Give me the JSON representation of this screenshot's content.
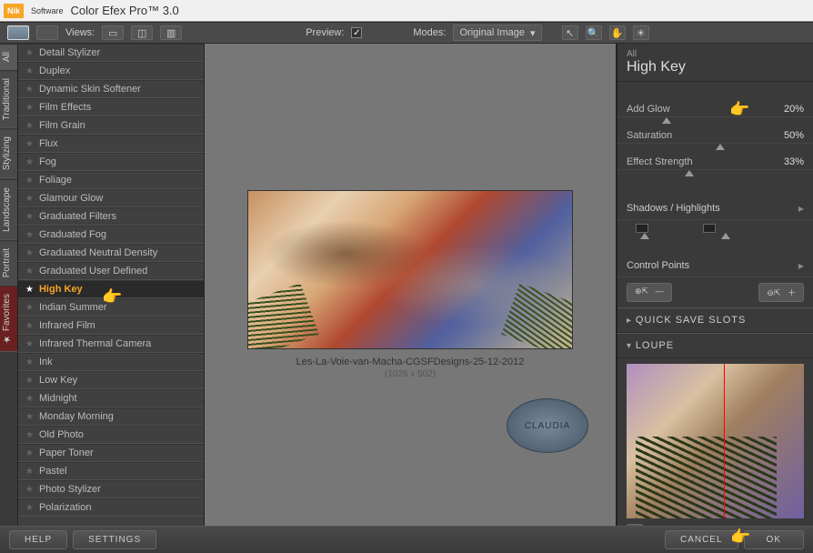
{
  "title": "Color Efex Pro™ 3.0",
  "brand": "Nik",
  "brand_sub": "Software",
  "toolbar": {
    "views": "Views:",
    "preview": "Preview:",
    "modes": "Modes:",
    "mode_value": "Original Image"
  },
  "tabs": [
    "All",
    "Traditional",
    "Stylizing",
    "Landscape",
    "Portrait",
    "Favorites"
  ],
  "filters": [
    {
      "label": "Detail Stylizer"
    },
    {
      "label": "Duplex"
    },
    {
      "label": "Dynamic Skin Softener"
    },
    {
      "label": "Film Effects"
    },
    {
      "label": "Film Grain"
    },
    {
      "label": "Flux"
    },
    {
      "label": "Fog"
    },
    {
      "label": "Foliage"
    },
    {
      "label": "Glamour Glow"
    },
    {
      "label": "Graduated Filters"
    },
    {
      "label": "Graduated Fog"
    },
    {
      "label": "Graduated Neutral Density"
    },
    {
      "label": "Graduated User Defined"
    },
    {
      "label": "High Key",
      "selected": true
    },
    {
      "label": "Indian Summer"
    },
    {
      "label": "Infrared Film"
    },
    {
      "label": "Infrared Thermal Camera"
    },
    {
      "label": "Ink"
    },
    {
      "label": "Low Key"
    },
    {
      "label": "Midnight"
    },
    {
      "label": "Monday Morning"
    },
    {
      "label": "Old Photo"
    },
    {
      "label": "Paper Toner"
    },
    {
      "label": "Pastel"
    },
    {
      "label": "Photo Stylizer"
    },
    {
      "label": "Polarization"
    }
  ],
  "image": {
    "name": "Les-La-Voie-van-Macha-CGSFDesigns-25-12-2012",
    "dims": "(1026 x 502)",
    "watermark": "CLAUDIA"
  },
  "panel": {
    "category": "All",
    "filter": "High Key",
    "params": [
      {
        "label": "Add Glow",
        "value": "20%",
        "pos": 20
      },
      {
        "label": "Saturation",
        "value": "50%",
        "pos": 50
      },
      {
        "label": "Effect Strength",
        "value": "33%",
        "pos": 33
      }
    ],
    "shadows": "Shadows / Highlights",
    "control": "Control Points",
    "quick": "QUICK SAVE SLOTS",
    "loupe": "LOUPE"
  },
  "footer": {
    "help": "HELP",
    "settings": "SETTINGS",
    "cancel": "CANCEL",
    "ok": "OK"
  }
}
